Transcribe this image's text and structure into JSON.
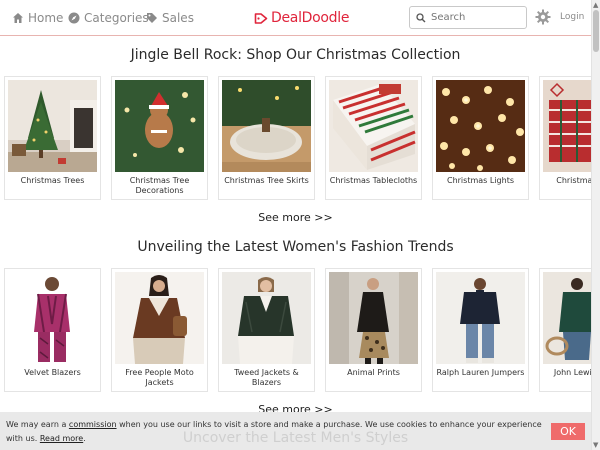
{
  "header": {
    "nav": [
      {
        "label": "Home",
        "icon": "home-icon"
      },
      {
        "label": "Categories",
        "icon": "compass-icon"
      },
      {
        "label": "Sales",
        "icon": "tag-icon"
      }
    ],
    "logo": "DealDoodle",
    "search_placeholder": "Search",
    "login_label": "Login"
  },
  "sections": [
    {
      "title": "Jingle Bell Rock: Shop Our Christmas Collection",
      "see_more": "See more >>",
      "items": [
        {
          "label": "Christmas Trees"
        },
        {
          "label": "Christmas Tree Decorations"
        },
        {
          "label": "Christmas Tree Skirts"
        },
        {
          "label": "Christmas Tablecloths"
        },
        {
          "label": "Christmas Lights"
        },
        {
          "label": "Christmas Bags"
        }
      ]
    },
    {
      "title": "Unveiling the Latest Women's Fashion Trends",
      "see_more": "See more >>",
      "items": [
        {
          "label": "Velvet Blazers"
        },
        {
          "label": "Free People Moto Jackets"
        },
        {
          "label": "Tweed Jackets & Blazers"
        },
        {
          "label": "Animal Prints"
        },
        {
          "label": "Ralph Lauren Jumpers"
        },
        {
          "label": "John Lewis Coats"
        }
      ]
    }
  ],
  "next_section_title": "Uncover the Latest Men's Styles",
  "cookie": {
    "text_before": "We may earn a ",
    "commission_link": "commission",
    "text_after": " when you use our links to visit a store and make a purchase. We use cookies to enhance your experience with us. ",
    "read_more": "Read more",
    "period": ".",
    "ok_label": "OK"
  },
  "colors": {
    "brand": "#e0253c",
    "ok_button": "#ef6b6b",
    "header_border": "#e8b4b0"
  }
}
